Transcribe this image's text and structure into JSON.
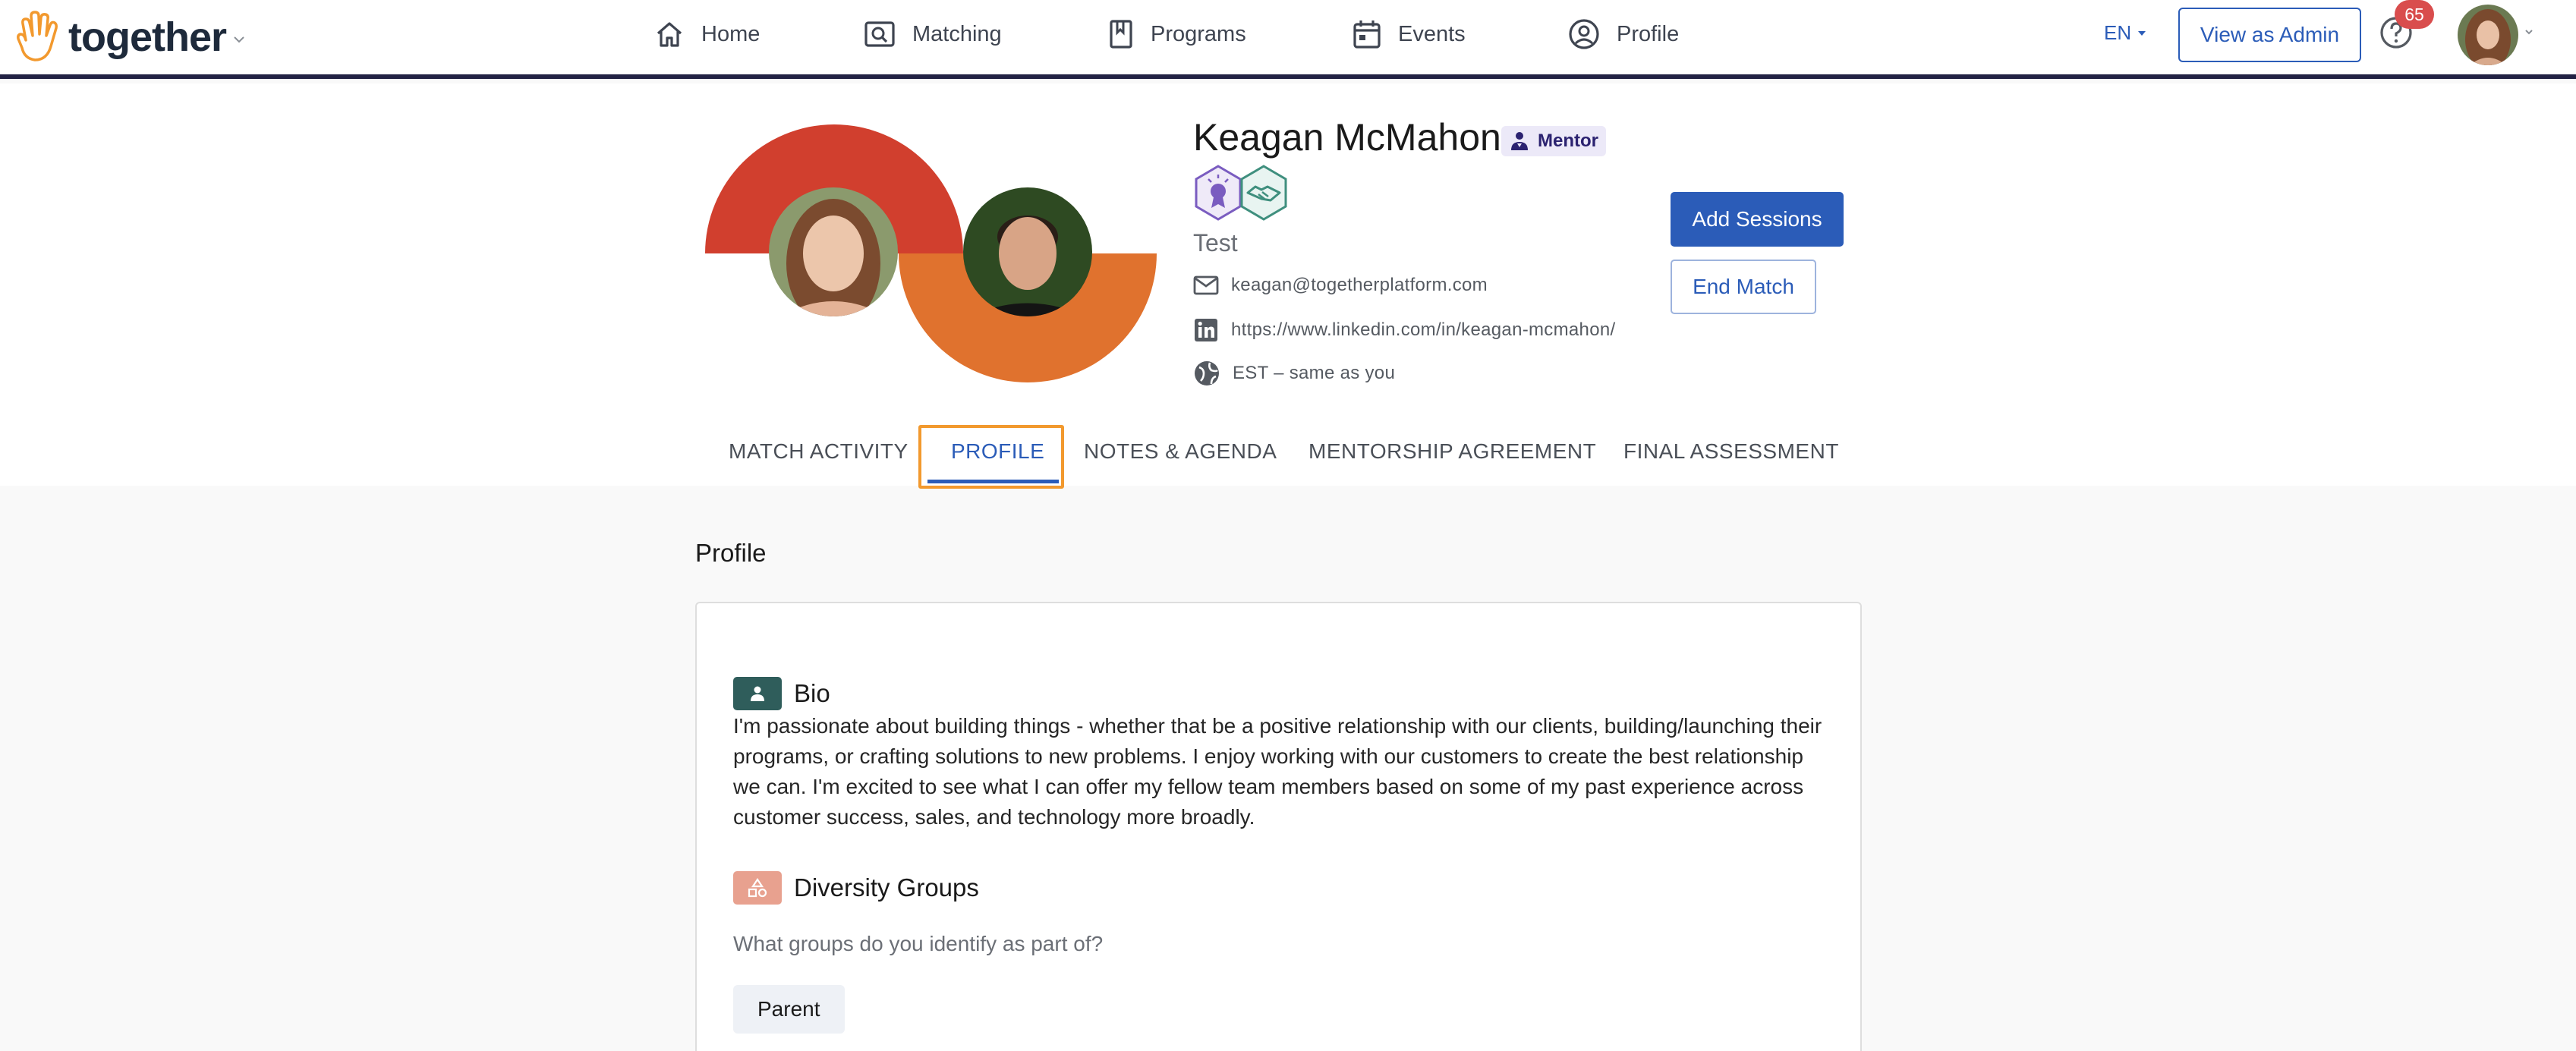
{
  "brand": {
    "name": "together"
  },
  "nav": {
    "items": [
      {
        "label": "Home",
        "icon": "home-icon"
      },
      {
        "label": "Matching",
        "icon": "matching-icon"
      },
      {
        "label": "Programs",
        "icon": "bookmark-icon"
      },
      {
        "label": "Events",
        "icon": "calendar-icon"
      },
      {
        "label": "Profile",
        "icon": "account-circle-icon"
      }
    ],
    "language": "EN",
    "view_as_admin": "View as Admin",
    "notification_count": "65"
  },
  "profile": {
    "name": "Keagan McMahon",
    "role": "Mentor",
    "subtitle": "Test",
    "email": "keagan@togetherplatform.com",
    "linkedin": "https://www.linkedin.com/in/keagan-mcmahon/",
    "timezone": "EST – same as you",
    "badges": [
      "award-badge-icon",
      "handshake-badge-icon"
    ]
  },
  "actions": {
    "add_sessions": "Add Sessions",
    "end_match": "End Match"
  },
  "tabs": {
    "items": [
      {
        "label": "MATCH ACTIVITY"
      },
      {
        "label": "PROFILE",
        "active": true
      },
      {
        "label": "NOTES & AGENDA"
      },
      {
        "label": "MENTORSHIP AGREEMENT"
      },
      {
        "label": "FINAL ASSESSMENT"
      }
    ]
  },
  "content": {
    "section_title": "Profile",
    "bio": {
      "heading": "Bio",
      "text": "I'm passionate about building things - whether that be a positive relationship with our clients, building/launching their programs, or crafting solutions to new problems. I enjoy working with our customers to create the best relationship we can. I'm excited to see what I can offer my fellow team members based on some of my past experience across customer success, sales, and technology more broadly."
    },
    "diversity": {
      "heading": "Diversity Groups",
      "question": "What groups do you identify as part of?",
      "groups": [
        "Parent"
      ]
    }
  },
  "colors": {
    "accent": "#2b5cb8",
    "nav_border": "#222244",
    "arc_red": "#d13f2e",
    "arc_orange": "#e0722e",
    "focus_outline": "#f2992e",
    "bio_icon_bg": "#2f5d5b",
    "diversity_icon_bg": "#e8a18f",
    "notification_badge": "#d94d4d"
  }
}
